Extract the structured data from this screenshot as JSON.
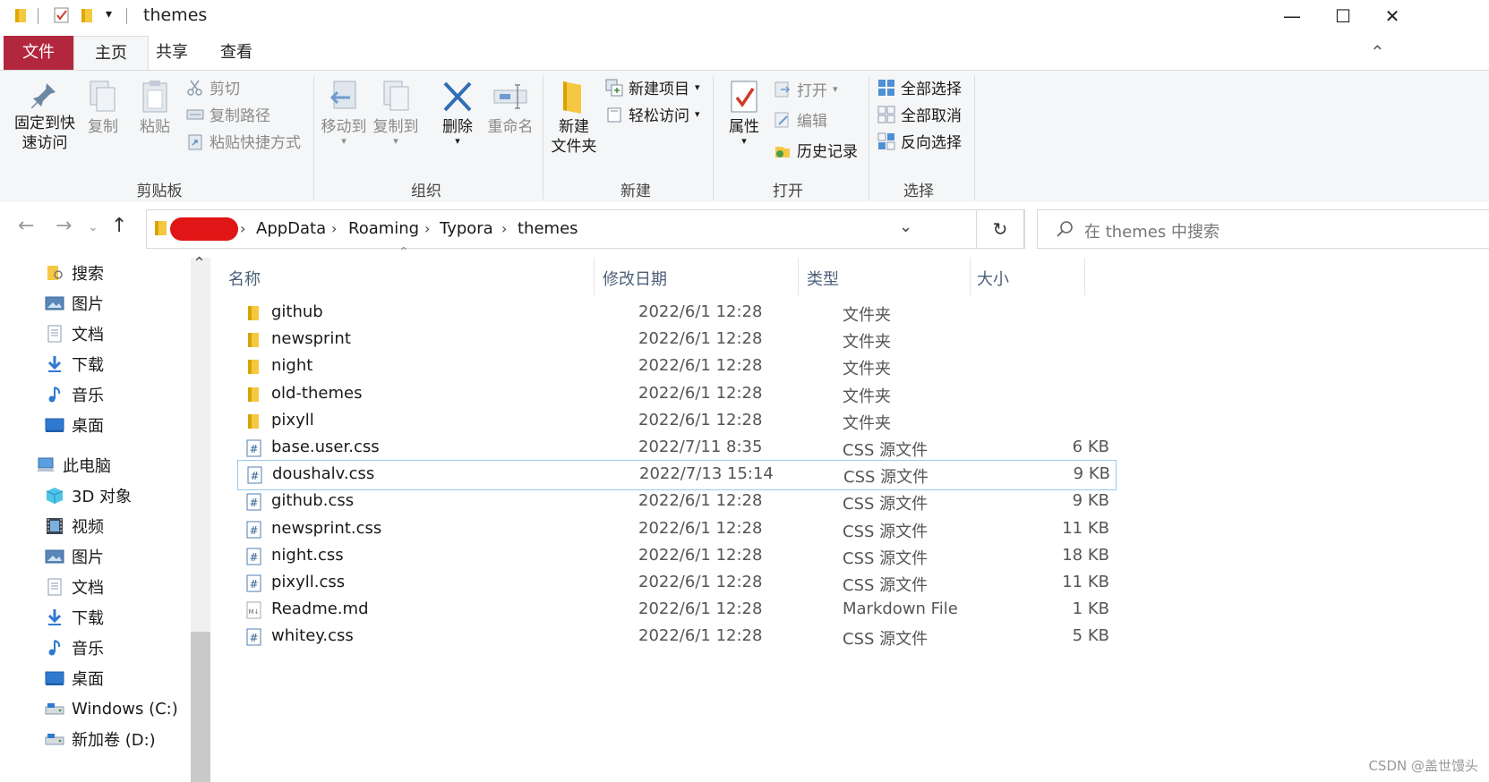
{
  "window": {
    "title": "themes",
    "quick_access_dropdown": "▾",
    "minimize": "—",
    "maximize": "☐",
    "close": "✕",
    "collapse_ribbon": "⌃"
  },
  "tabs": [
    "文件",
    "主页",
    "共享",
    "查看"
  ],
  "ribbon": {
    "clipboard": {
      "label": "剪贴板",
      "pin": "固定到快\n速访问",
      "copy": "复制",
      "paste": "粘贴",
      "cut": "剪切",
      "copy_path": "复制路径",
      "paste_shortcut": "粘贴快捷方式"
    },
    "organize": {
      "label": "组织",
      "move_to": "移动到",
      "copy_to": "复制到",
      "delete": "删除",
      "rename": "重命名"
    },
    "new": {
      "label": "新建",
      "new_folder": "新建\n文件夹",
      "new_item": "新建项目",
      "easy_access": "轻松访问"
    },
    "open": {
      "label": "打开",
      "properties": "属性",
      "open": "打开",
      "edit": "编辑",
      "history": "历史记录"
    },
    "select": {
      "label": "选择",
      "select_all": "全部选择",
      "select_none": "全部取消",
      "invert": "反向选择"
    }
  },
  "address": {
    "crumbs": [
      "AppData",
      "Roaming",
      "Typora",
      "themes"
    ],
    "search_placeholder": "在 themes 中搜索"
  },
  "sidebar": {
    "items": [
      {
        "label": "搜索",
        "icon": "folder-search-icon"
      },
      {
        "label": "图片",
        "icon": "pictures-icon"
      },
      {
        "label": "文档",
        "icon": "documents-icon"
      },
      {
        "label": "下载",
        "icon": "download-icon"
      },
      {
        "label": "音乐",
        "icon": "music-icon"
      },
      {
        "label": "桌面",
        "icon": "desktop-icon"
      },
      {
        "label": "此电脑",
        "icon": "computer-icon"
      },
      {
        "label": "3D 对象",
        "icon": "3d-objects-icon"
      },
      {
        "label": "视频",
        "icon": "videos-icon"
      },
      {
        "label": "图片",
        "icon": "pictures-icon"
      },
      {
        "label": "文档",
        "icon": "documents-icon"
      },
      {
        "label": "下载",
        "icon": "download-icon"
      },
      {
        "label": "音乐",
        "icon": "music-icon"
      },
      {
        "label": "桌面",
        "icon": "desktop-icon"
      },
      {
        "label": "Windows (C:)",
        "icon": "drive-icon"
      },
      {
        "label": "新加卷 (D:)",
        "icon": "drive-icon"
      }
    ]
  },
  "columns": {
    "name": "名称",
    "date": "修改日期",
    "type": "类型",
    "size": "大小"
  },
  "files": [
    {
      "name": "github",
      "date": "2022/6/1 12:28",
      "type": "文件夹",
      "size": "",
      "kind": "folder"
    },
    {
      "name": "newsprint",
      "date": "2022/6/1 12:28",
      "type": "文件夹",
      "size": "",
      "kind": "folder"
    },
    {
      "name": "night",
      "date": "2022/6/1 12:28",
      "type": "文件夹",
      "size": "",
      "kind": "folder"
    },
    {
      "name": "old-themes",
      "date": "2022/6/1 12:28",
      "type": "文件夹",
      "size": "",
      "kind": "folder"
    },
    {
      "name": "pixyll",
      "date": "2022/6/1 12:28",
      "type": "文件夹",
      "size": "",
      "kind": "folder"
    },
    {
      "name": "base.user.css",
      "date": "2022/7/11 8:35",
      "type": "CSS 源文件",
      "size": "6 KB",
      "kind": "css"
    },
    {
      "name": "doushalv.css",
      "date": "2022/7/13 15:14",
      "type": "CSS 源文件",
      "size": "9 KB",
      "kind": "css",
      "selected": true
    },
    {
      "name": "github.css",
      "date": "2022/6/1 12:28",
      "type": "CSS 源文件",
      "size": "9 KB",
      "kind": "css"
    },
    {
      "name": "newsprint.css",
      "date": "2022/6/1 12:28",
      "type": "CSS 源文件",
      "size": "11 KB",
      "kind": "css"
    },
    {
      "name": "night.css",
      "date": "2022/6/1 12:28",
      "type": "CSS 源文件",
      "size": "18 KB",
      "kind": "css"
    },
    {
      "name": "pixyll.css",
      "date": "2022/6/1 12:28",
      "type": "CSS 源文件",
      "size": "11 KB",
      "kind": "css"
    },
    {
      "name": "Readme.md",
      "date": "2022/6/1 12:28",
      "type": "Markdown File",
      "size": "1 KB",
      "kind": "md"
    },
    {
      "name": "whitey.css",
      "date": "2022/6/1 12:28",
      "type": "CSS 源文件",
      "size": "5 KB",
      "kind": "css"
    }
  ],
  "watermark": "CSDN @盖世馒头",
  "colors": {
    "accent_file_tab": "#b3273e",
    "folder": "#f5c842",
    "selection_border": "#99c9ef"
  }
}
